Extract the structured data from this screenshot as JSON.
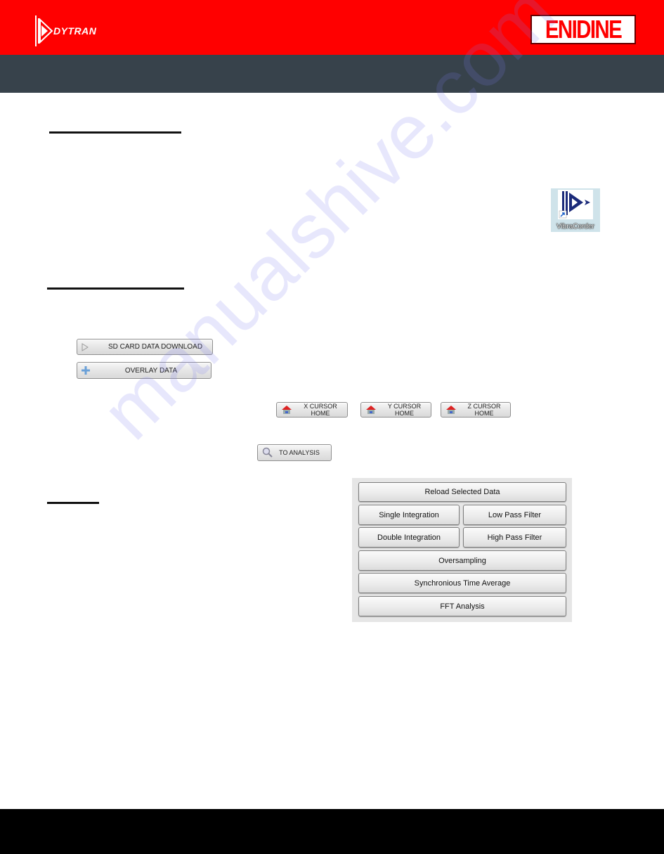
{
  "header": {
    "left_logo": "DYTRAN",
    "right_logo": "ENIDINE",
    "colors": {
      "red_bar": "#ff0000",
      "dark_bar": "#37424b",
      "footer": "#000000"
    }
  },
  "desktop_icon": {
    "label": "VibraCorder",
    "icon": "vibracorder-app-icon"
  },
  "toolbar_buttons": {
    "sd_card": {
      "label": "SD CARD DATA DOWNLOAD",
      "icon": "play-triangle-icon"
    },
    "overlay": {
      "label": "OVERLAY DATA",
      "icon": "plus-icon"
    }
  },
  "cursor_buttons": [
    {
      "label": "X CURSOR HOME",
      "icon": "home-icon"
    },
    {
      "label": "Y CURSOR HOME",
      "icon": "home-icon"
    },
    {
      "label": "Z CURSOR HOME",
      "icon": "home-icon"
    }
  ],
  "analysis_button": {
    "label": "TO ANALYSIS",
    "icon": "magnifier-icon"
  },
  "processing_panel": {
    "reload": "Reload Selected Data",
    "single_integration": "Single Integration",
    "low_pass": "Low Pass Filter",
    "double_integration": "Double Integration",
    "high_pass": "High Pass Filter",
    "oversampling": "Oversampling",
    "sync_time_avg": "Synchronious Time Average",
    "fft": "FFT Analysis"
  },
  "watermark": "manualshive.com"
}
